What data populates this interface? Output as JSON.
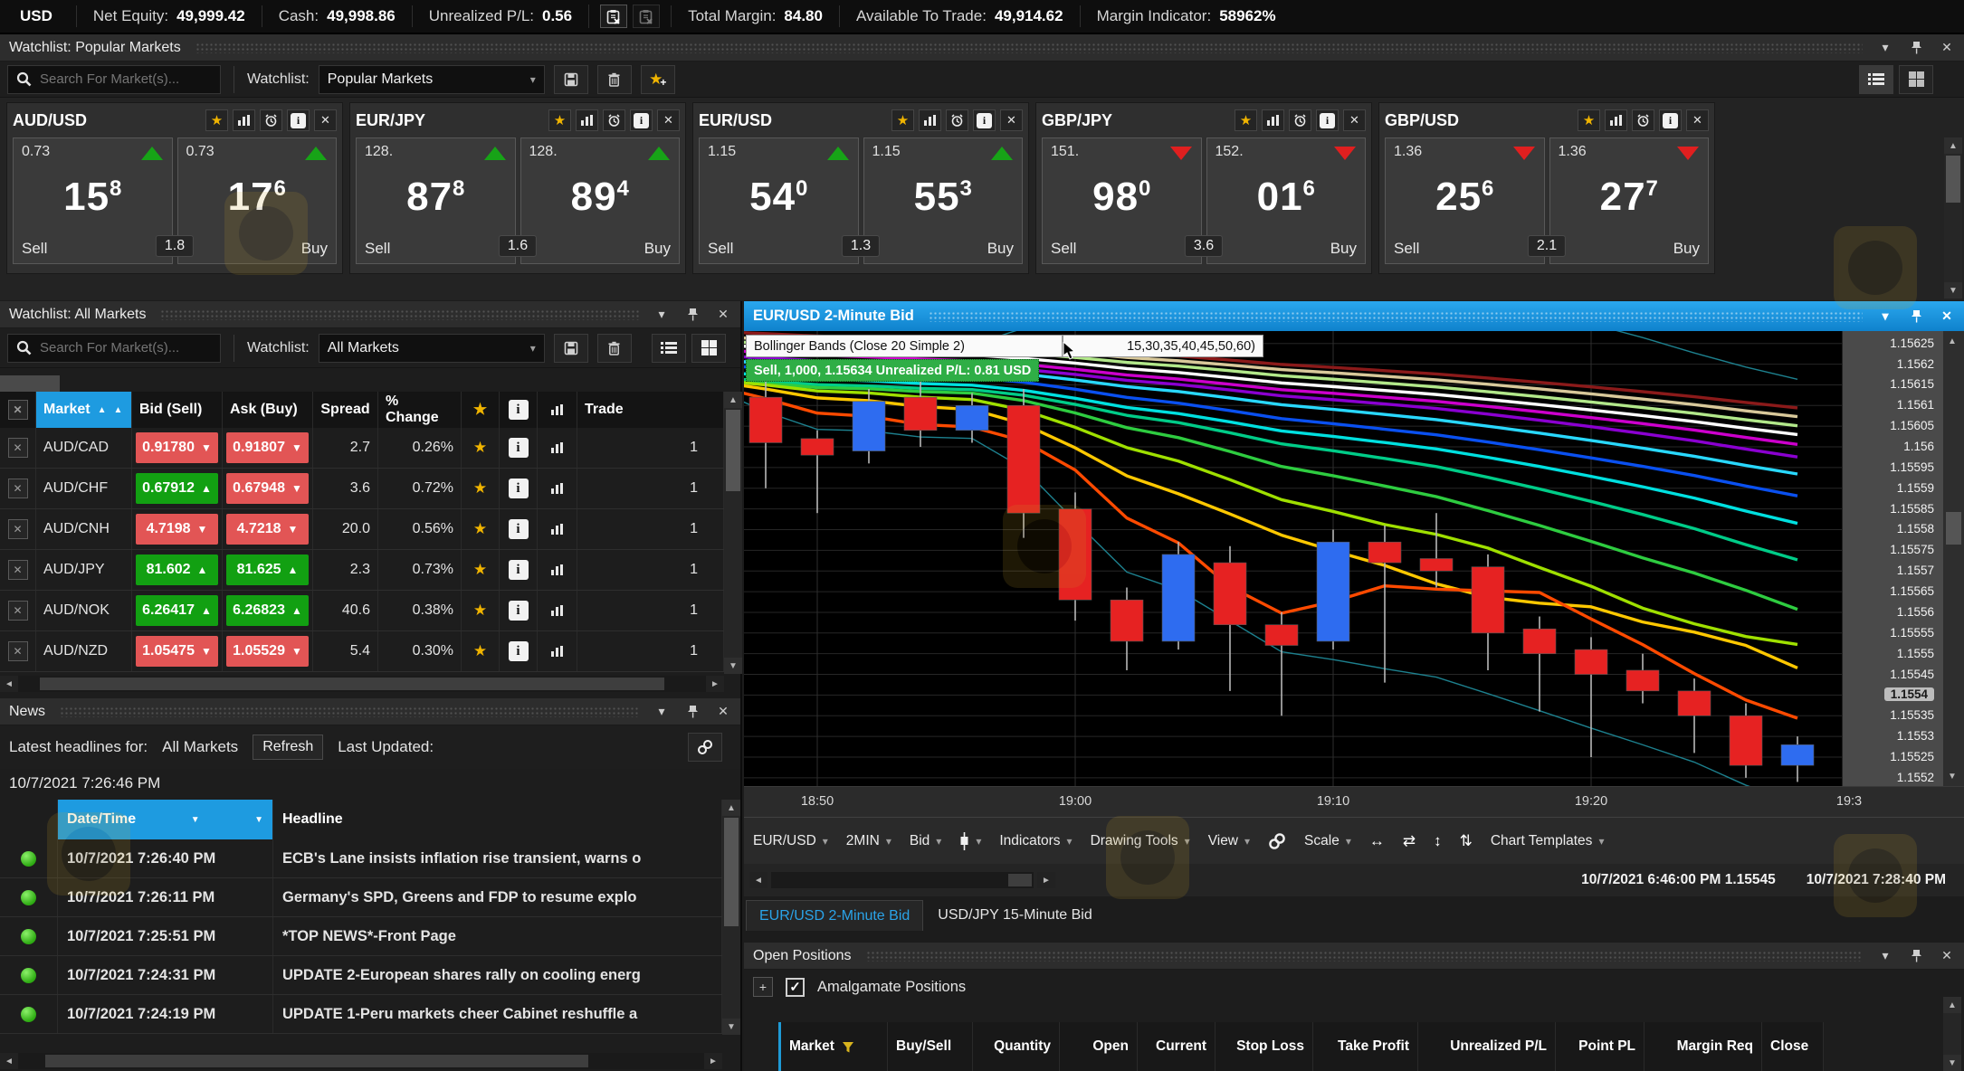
{
  "icons": {
    "caret_down": "▾",
    "close": "✕",
    "star": "★",
    "up_triangle": "▲",
    "down_triangle": "▼",
    "left_arrow": "◄",
    "right_arrow": "►",
    "check": "✓",
    "plus": "+",
    "info": "i"
  },
  "top_bar": {
    "currency": "USD",
    "items": [
      {
        "label": "Net Equity:",
        "value": "49,999.42"
      },
      {
        "label": "Cash:",
        "value": "49,998.86"
      },
      {
        "label": "Unrealized P/L:",
        "value": "0.56"
      },
      {
        "label": "Total Margin:",
        "value": "84.80"
      },
      {
        "label": "Available To Trade:",
        "value": "49,914.62"
      },
      {
        "label": "Margin Indicator:",
        "value": "58962%"
      }
    ]
  },
  "popular": {
    "title": "Watchlist: Popular Markets",
    "search_placeholder": "Search For Market(s)...",
    "watchlist_label": "Watchlist:",
    "watchlist_value": "Popular Markets",
    "tiles": [
      {
        "market": "AUD/USD",
        "dir": "up",
        "sell": {
          "prefix": "0.73",
          "big": "15",
          "sup": "8"
        },
        "buy": {
          "prefix": "0.73",
          "big": "17",
          "sup": "6"
        },
        "spread": "1.8",
        "sell_label": "Sell",
        "buy_label": "Buy"
      },
      {
        "market": "EUR/JPY",
        "dir": "up",
        "sell": {
          "prefix": "128.",
          "big": "87",
          "sup": "8"
        },
        "buy": {
          "prefix": "128.",
          "big": "89",
          "sup": "4"
        },
        "spread": "1.6",
        "sell_label": "Sell",
        "buy_label": "Buy"
      },
      {
        "market": "EUR/USD",
        "dir": "up",
        "sell": {
          "prefix": "1.15",
          "big": "54",
          "sup": "0"
        },
        "buy": {
          "prefix": "1.15",
          "big": "55",
          "sup": "3"
        },
        "spread": "1.3",
        "sell_label": "Sell",
        "buy_label": "Buy"
      },
      {
        "market": "GBP/JPY",
        "dir": "down",
        "sell": {
          "prefix": "151.",
          "big": "98",
          "sup": "0"
        },
        "buy": {
          "prefix": "152.",
          "big": "01",
          "sup": "6"
        },
        "spread": "3.6",
        "sell_label": "Sell",
        "buy_label": "Buy"
      },
      {
        "market": "GBP/USD",
        "dir": "down",
        "sell": {
          "prefix": "1.36",
          "big": "25",
          "sup": "6"
        },
        "buy": {
          "prefix": "1.36",
          "big": "27",
          "sup": "7"
        },
        "spread": "2.1",
        "sell_label": "Sell",
        "buy_label": "Buy"
      }
    ]
  },
  "all_markets": {
    "title": "Watchlist: All Markets",
    "search_placeholder": "Search For Market(s)...",
    "watchlist_label": "Watchlist:",
    "watchlist_value": "All Markets",
    "columns": [
      "Market",
      "Bid (Sell)",
      "Ask (Buy)",
      "Spread",
      "% Change",
      "Trade"
    ],
    "rows": [
      {
        "market": "AUD/CAD",
        "bid": "0.91780",
        "bid_dir": "down",
        "ask": "0.91807",
        "ask_dir": "down",
        "spread": "2.7",
        "change": "0.26%",
        "trade": "1"
      },
      {
        "market": "AUD/CHF",
        "bid": "0.67912",
        "bid_dir": "up",
        "ask": "0.67948",
        "ask_dir": "down",
        "spread": "3.6",
        "change": "0.72%",
        "trade": "1"
      },
      {
        "market": "AUD/CNH",
        "bid": "4.7198",
        "bid_dir": "down",
        "ask": "4.7218",
        "ask_dir": "down",
        "spread": "20.0",
        "change": "0.56%",
        "trade": "1"
      },
      {
        "market": "AUD/JPY",
        "bid": "81.602",
        "bid_dir": "up",
        "ask": "81.625",
        "ask_dir": "up",
        "spread": "2.3",
        "change": "0.73%",
        "trade": "1"
      },
      {
        "market": "AUD/NOK",
        "bid": "6.26417",
        "bid_dir": "up",
        "ask": "6.26823",
        "ask_dir": "up",
        "spread": "40.6",
        "change": "0.38%",
        "trade": "1"
      },
      {
        "market": "AUD/NZD",
        "bid": "1.05475",
        "bid_dir": "down",
        "ask": "1.05529",
        "ask_dir": "down",
        "spread": "5.4",
        "change": "0.30%",
        "trade": "1"
      }
    ]
  },
  "news": {
    "title": "News",
    "headlines_label": "Latest headlines for:",
    "scope": "All Markets",
    "refresh_label": "Refresh",
    "last_updated_label": "Last Updated:",
    "updated_value": "10/7/2021 7:26:46 PM",
    "columns": [
      "Date/Time",
      "Headline"
    ],
    "rows": [
      {
        "datetime": "10/7/2021 7:26:40 PM",
        "headline": "ECB's Lane insists inflation rise transient, warns o"
      },
      {
        "datetime": "10/7/2021 7:26:11 PM",
        "headline": "Germany's SPD, Greens and FDP to resume explo"
      },
      {
        "datetime": "10/7/2021 7:25:51 PM",
        "headline": "*TOP NEWS*-Front Page"
      },
      {
        "datetime": "10/7/2021 7:24:31 PM",
        "headline": "UPDATE 2-European shares rally on cooling energ"
      },
      {
        "datetime": "10/7/2021 7:24:19 PM",
        "headline": "UPDATE 1-Peru markets cheer Cabinet reshuffle a"
      }
    ]
  },
  "chart": {
    "title": "EUR/USD 2-Minute Bid",
    "overlays": {
      "bollinger_label": "Bollinger Bands (Close 20 Simple 2)",
      "ma_label_fragment": "15,30,35,40,45,50,60)",
      "position_label": "Sell, 1,000, 1.15634 Unrealized P/L: 0.81 USD"
    },
    "toolbar": {
      "items": [
        {
          "label": "EUR/USD",
          "caret": true
        },
        {
          "label": "2MIN",
          "caret": true
        },
        {
          "label": "Bid",
          "caret": true
        },
        {
          "icon": "candlestick",
          "caret": true
        },
        {
          "label": "Indicators",
          "caret": true
        },
        {
          "label": "Drawing Tools",
          "caret": true
        },
        {
          "label": "View",
          "caret": true
        },
        {
          "icon": "link"
        },
        {
          "label": "Scale",
          "caret": true
        },
        {
          "icon": "scale-glyphs"
        },
        {
          "label": "Chart Templates",
          "caret": true
        }
      ]
    },
    "scale_icons": [
      "↔",
      "⇄",
      "↕",
      "⇅"
    ],
    "range_start": "10/7/2021 6:46:00 PM 1.15545",
    "range_end": "10/7/2021 7:28:40 PM",
    "tabs": [
      {
        "label": "EUR/USD 2-Minute Bid",
        "active": true
      },
      {
        "label": "USD/JPY 15-Minute Bid",
        "active": false
      }
    ],
    "chart_data": {
      "type": "candlestick",
      "symbol": "EUR/USD",
      "interval": "2MIN",
      "price_field": "Bid",
      "title": "EUR/USD 2-Minute Bid",
      "x_labels": [
        "18:50",
        "19:00",
        "19:10",
        "19:20",
        "19:3"
      ],
      "x_label_indices": [
        1,
        6,
        11,
        16,
        21
      ],
      "y_ticks": [
        "1.15625",
        "1.1562",
        "1.15615",
        "1.1561",
        "1.15605",
        "1.156",
        "1.15595",
        "1.1559",
        "1.15585",
        "1.1558",
        "1.15575",
        "1.1557",
        "1.15565",
        "1.1556",
        "1.15555",
        "1.1555",
        "1.15545",
        "1.1554",
        "1.15535",
        "1.1553",
        "1.15525",
        "1.1552"
      ],
      "current_price": "1.1554",
      "ylim": [
        1.15518,
        1.15628
      ],
      "grid": true,
      "bull_color": "#2e6cf0",
      "bear_color": "#e62222",
      "candles": [
        [
          "18:48",
          1.15612,
          1.15616,
          1.1559,
          1.15601
        ],
        [
          "18:50",
          1.15602,
          1.15604,
          1.15584,
          1.15598
        ],
        [
          "18:52",
          1.15599,
          1.15614,
          1.15596,
          1.15611
        ],
        [
          "18:54",
          1.15612,
          1.15617,
          1.156,
          1.15604
        ],
        [
          "18:56",
          1.15604,
          1.15613,
          1.15601,
          1.1561
        ],
        [
          "18:58",
          1.1561,
          1.15614,
          1.15578,
          1.15584
        ],
        [
          "19:00",
          1.15585,
          1.15589,
          1.15558,
          1.15563
        ],
        [
          "19:02",
          1.15563,
          1.15566,
          1.15546,
          1.15553
        ],
        [
          "19:04",
          1.15553,
          1.15577,
          1.15551,
          1.15574
        ],
        [
          "19:06",
          1.15572,
          1.15576,
          1.15541,
          1.15557
        ],
        [
          "19:08",
          1.15557,
          1.1556,
          1.15535,
          1.15552
        ],
        [
          "19:10",
          1.15553,
          1.1558,
          1.15551,
          1.15577
        ],
        [
          "19:12",
          1.15577,
          1.15581,
          1.15543,
          1.15572
        ],
        [
          "19:14",
          1.15573,
          1.15584,
          1.15566,
          1.1557
        ],
        [
          "19:16",
          1.15571,
          1.15574,
          1.15546,
          1.15555
        ],
        [
          "19:18",
          1.15556,
          1.15559,
          1.15536,
          1.1555
        ],
        [
          "19:20",
          1.15551,
          1.15554,
          1.15525,
          1.15545
        ],
        [
          "19:22",
          1.15546,
          1.1555,
          1.15538,
          1.15541
        ],
        [
          "19:24",
          1.15541,
          1.15544,
          1.15526,
          1.15535
        ],
        [
          "19:26",
          1.15535,
          1.15538,
          1.1552,
          1.15523
        ],
        [
          "19:28",
          1.15523,
          1.1553,
          1.15519,
          1.15528
        ]
      ],
      "indicators": {
        "bollinger": {
          "period": 20,
          "stdev": 2,
          "color": "#1d808e"
        },
        "moving_averages": [
          {
            "period": 82,
            "color": "#8b1a1a"
          },
          {
            "period": 76,
            "color": "#d8c89a"
          },
          {
            "period": 70,
            "color": "#b2e88a"
          },
          {
            "period": 64,
            "color": "#ffffff"
          },
          {
            "period": 58,
            "color": "#cc00cc"
          },
          {
            "period": 52,
            "color": "#8a00d0"
          },
          {
            "period": 45,
            "color": "#29d8ff"
          },
          {
            "period": 37,
            "color": "#0a50f0"
          },
          {
            "period": 30,
            "color": "#00e0e0"
          },
          {
            "period": 24,
            "color": "#00cc88"
          },
          {
            "period": 18,
            "color": "#2ecc40"
          },
          {
            "period": 13,
            "color": "#9fe000"
          },
          {
            "period": 9,
            "color": "#ffc800"
          },
          {
            "period": 5,
            "color": "#ff4a00"
          }
        ]
      }
    }
  },
  "open_positions": {
    "title": "Open Positions",
    "amalgamate_label": "Amalgamate Positions",
    "columns": [
      "Market",
      "Buy/Sell",
      "Quantity",
      "Open",
      "Current",
      "Stop Loss",
      "Take Profit",
      "Unrealized P/L",
      "Point PL",
      "Margin Req",
      "Close"
    ]
  }
}
